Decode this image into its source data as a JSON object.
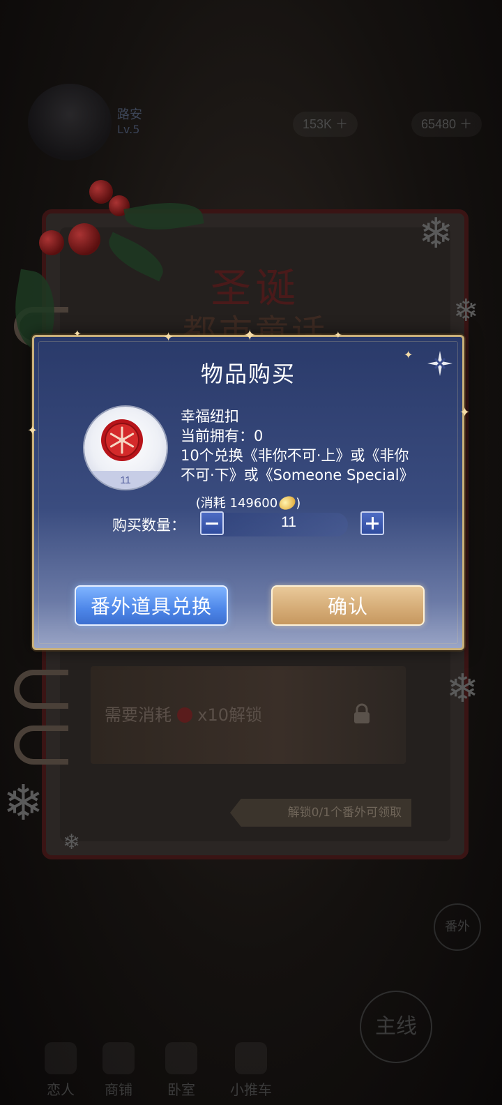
{
  "background": {
    "top_bar": {
      "name": "路安",
      "subtitle": "Lv.5",
      "resource_1": "153K",
      "resource_2": "65480"
    },
    "notebook": {
      "title_line1": "圣诞",
      "title_line2": "都市童话",
      "locked_card_text": "需要消耗",
      "locked_card_suffix": "x10解锁",
      "unlock_banner": "解锁0/1个番外可领取"
    },
    "bottom_nav": [
      {
        "label": "恋人"
      },
      {
        "label": "商铺"
      },
      {
        "label": "卧室"
      },
      {
        "label": "小推车"
      }
    ],
    "main_button": "主线",
    "side_badge": "番外"
  },
  "dialog": {
    "title": "物品购买",
    "item": {
      "name": "幸福纽扣",
      "owned_line": "当前拥有：0",
      "description_line1": "10个兑换《非你不可·上》或《非你",
      "description_line2": "不可·下》或《Someone Special》",
      "badge_count": "11",
      "icon": "snowflake-button-icon"
    },
    "cost_prefix": "(消耗",
    "cost_value": "149600",
    "cost_suffix": ")",
    "quantity_label": "购买数量：",
    "quantity_value": "11",
    "exchange_button": "番外道具兑换",
    "confirm_button": "确认"
  },
  "colors": {
    "dialog_top": "#2a3a6a",
    "dialog_bottom": "#9aa5c6",
    "gold_border": "#c9b07a",
    "exchange_button": "#4d86e8",
    "confirm_button": "#d6ad78"
  }
}
